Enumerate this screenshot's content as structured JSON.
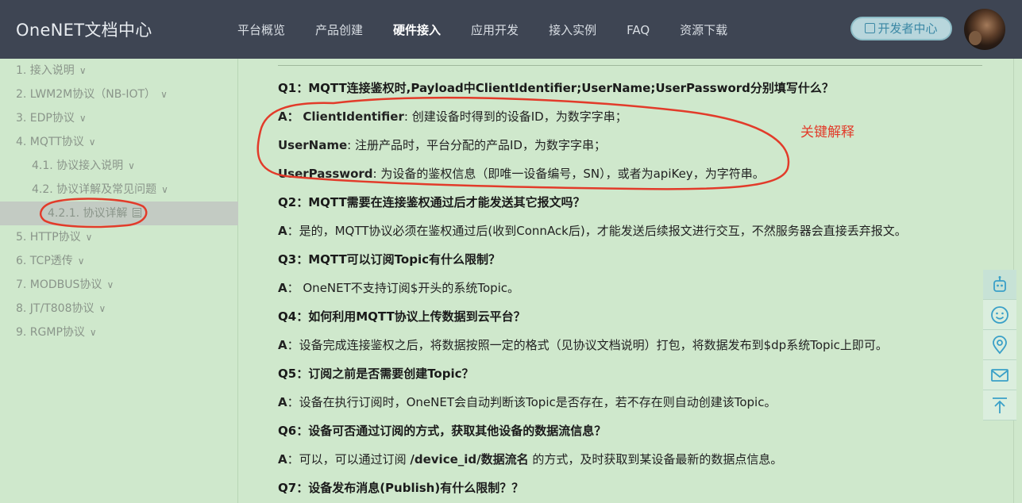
{
  "header": {
    "brand": "OneNET文档中心",
    "nav": [
      "平台概览",
      "产品创建",
      "硬件接入",
      "应用开发",
      "接入实例",
      "FAQ",
      "资源下载"
    ],
    "active_nav": "硬件接入",
    "dev_button": "开发者中心"
  },
  "sidebar": {
    "items": [
      "1. 接入说明",
      "2. LWM2M协议（NB-IOT）",
      "3. EDP协议",
      "4. MQTT协议",
      "4.1. 协议接入说明",
      "4.2. 协议详解及常见问题",
      "4.2.1. 协议详解",
      "5. HTTP协议",
      "6. TCP透传",
      "7. MODBUS协议",
      "8. JT/T808协议",
      "9. RGMP协议"
    ]
  },
  "faq": {
    "q1": "Q1：MQTT连接鉴权时,Payload中ClientIdentifier;UserName;UserPassword分别填写什么？",
    "a1_prefix": "A：",
    "a1_key1": "ClientIdentifier",
    "a1_val1": ": 创建设备时得到的设备ID，为数字字串；",
    "a1_key2": "UserName",
    "a1_val2": ": 注册产品时，平台分配的产品ID，为数字字串；",
    "a1_key3": "UserPassword",
    "a1_val3": ": 为设备的鉴权信息（即唯一设备编号，SN），或者为apiKey，为字符串。",
    "q2": "Q2：MQTT需要在连接鉴权通过后才能发送其它报文吗？",
    "a2_prefix": "A",
    "a2": "：是的，MQTT协议必须在鉴权通过后(收到ConnAck后)，才能发送后续报文进行交互，不然服务器会直接丢弃报文。",
    "q3": "Q3：MQTT可以订阅Topic有什么限制？",
    "a3_prefix": "A",
    "a3": "： OneNET不支持订阅$开头的系统Topic。",
    "q4": "Q4：如何利用MQTT协议上传数据到云平台？",
    "a4_prefix": "A",
    "a4": "：设备完成连接鉴权之后，将数据按照一定的格式（见协议文档说明）打包，将数据发布到$dp系统Topic上即可。",
    "q5": "Q5：订阅之前是否需要创建Topic？",
    "a5_prefix": "A",
    "a5": "：设备在执行订阅时，OneNET会自动判断该Topic是否存在，若不存在则自动创建该Topic。",
    "q6": "Q6：设备可否通过订阅的方式，获取其他设备的数据流信息？",
    "a6_prefix": "A",
    "a6_pre": "：可以，可以通过订阅 ",
    "a6_bold": "/device_id/数据流名",
    "a6_post": " 的方式，及时获取到某设备最新的数据点信息。",
    "q7": "Q7：设备发布消息(Publish)有什么限制？？"
  },
  "annotation": "关键解释",
  "tools": [
    "robot-icon",
    "smile-icon",
    "location-icon",
    "mail-icon",
    "back-to-top-icon"
  ],
  "colors": {
    "header_bg": "#3e4553",
    "page_bg": "#cfe8cc",
    "annotation_red": "#e23b2a",
    "accent_teal": "#3b88a5"
  }
}
